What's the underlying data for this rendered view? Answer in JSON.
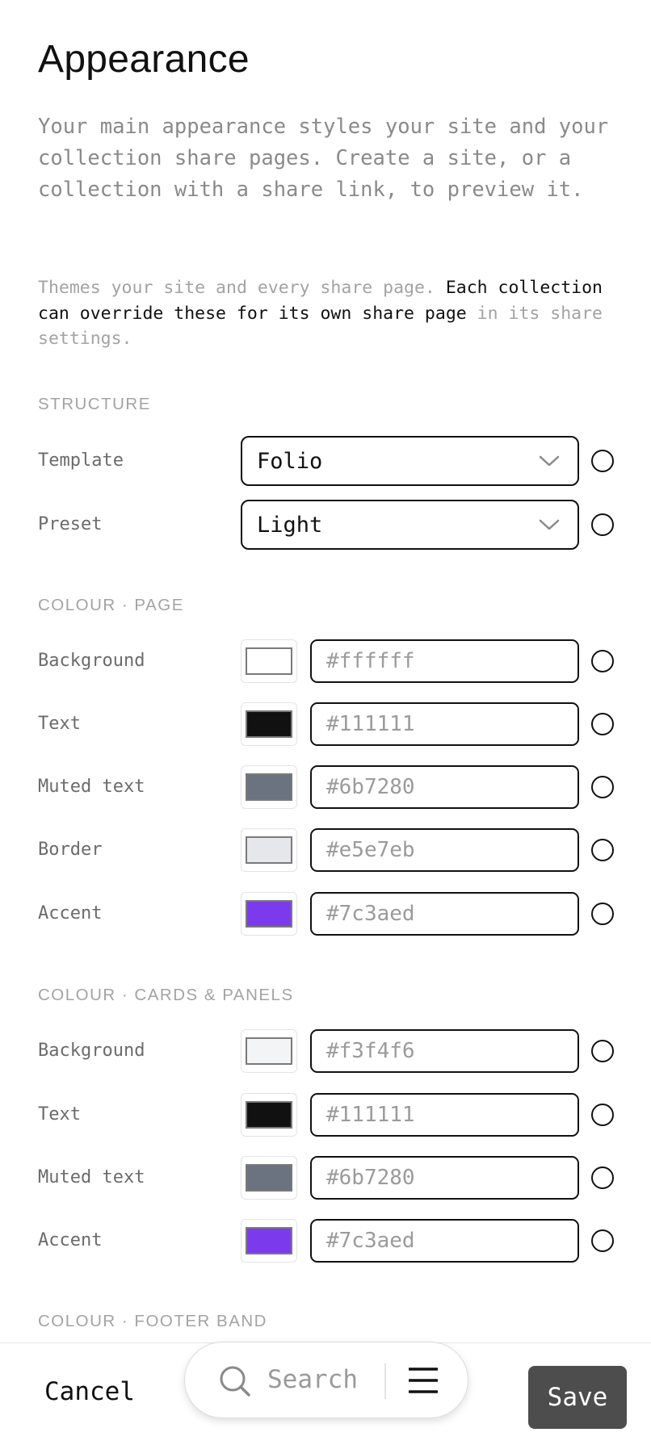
{
  "header": {
    "title": "Appearance",
    "intro": "Your main appearance styles your site and your collection share pages. Create a site, or a collection with a share link, to preview it.",
    "note_prefix": "Themes your site and every share page. ",
    "note_strong": "Each collection can override these for its own share page",
    "note_suffix": " in its share settings."
  },
  "structure": {
    "label": "STRUCTURE",
    "rows": [
      {
        "label": "Template",
        "value": "Folio"
      },
      {
        "label": "Preset",
        "value": "Light"
      }
    ]
  },
  "colour_page": {
    "label": "COLOUR · PAGE",
    "rows": [
      {
        "label": "Background",
        "placeholder": "#ffffff",
        "color": "#ffffff"
      },
      {
        "label": "Text",
        "placeholder": "#111111",
        "color": "#111111"
      },
      {
        "label": "Muted text",
        "placeholder": "#6b7280",
        "color": "#6b7280"
      },
      {
        "label": "Border",
        "placeholder": "#e5e7eb",
        "color": "#e5e7eb"
      },
      {
        "label": "Accent",
        "placeholder": "#7c3aed",
        "color": "#7c3aed"
      }
    ]
  },
  "colour_cards": {
    "label": "COLOUR · CARDS & PANELS",
    "rows": [
      {
        "label": "Background",
        "placeholder": "#f3f4f6",
        "color": "#f3f4f6"
      },
      {
        "label": "Text",
        "placeholder": "#111111",
        "color": "#111111"
      },
      {
        "label": "Muted text",
        "placeholder": "#6b7280",
        "color": "#6b7280"
      },
      {
        "label": "Accent",
        "placeholder": "#7c3aed",
        "color": "#7c3aed"
      }
    ]
  },
  "colour_footer": {
    "label": "COLOUR · FOOTER BAND"
  },
  "bottom_bar": {
    "cancel": "Cancel",
    "search": "Search",
    "save": "Save"
  }
}
